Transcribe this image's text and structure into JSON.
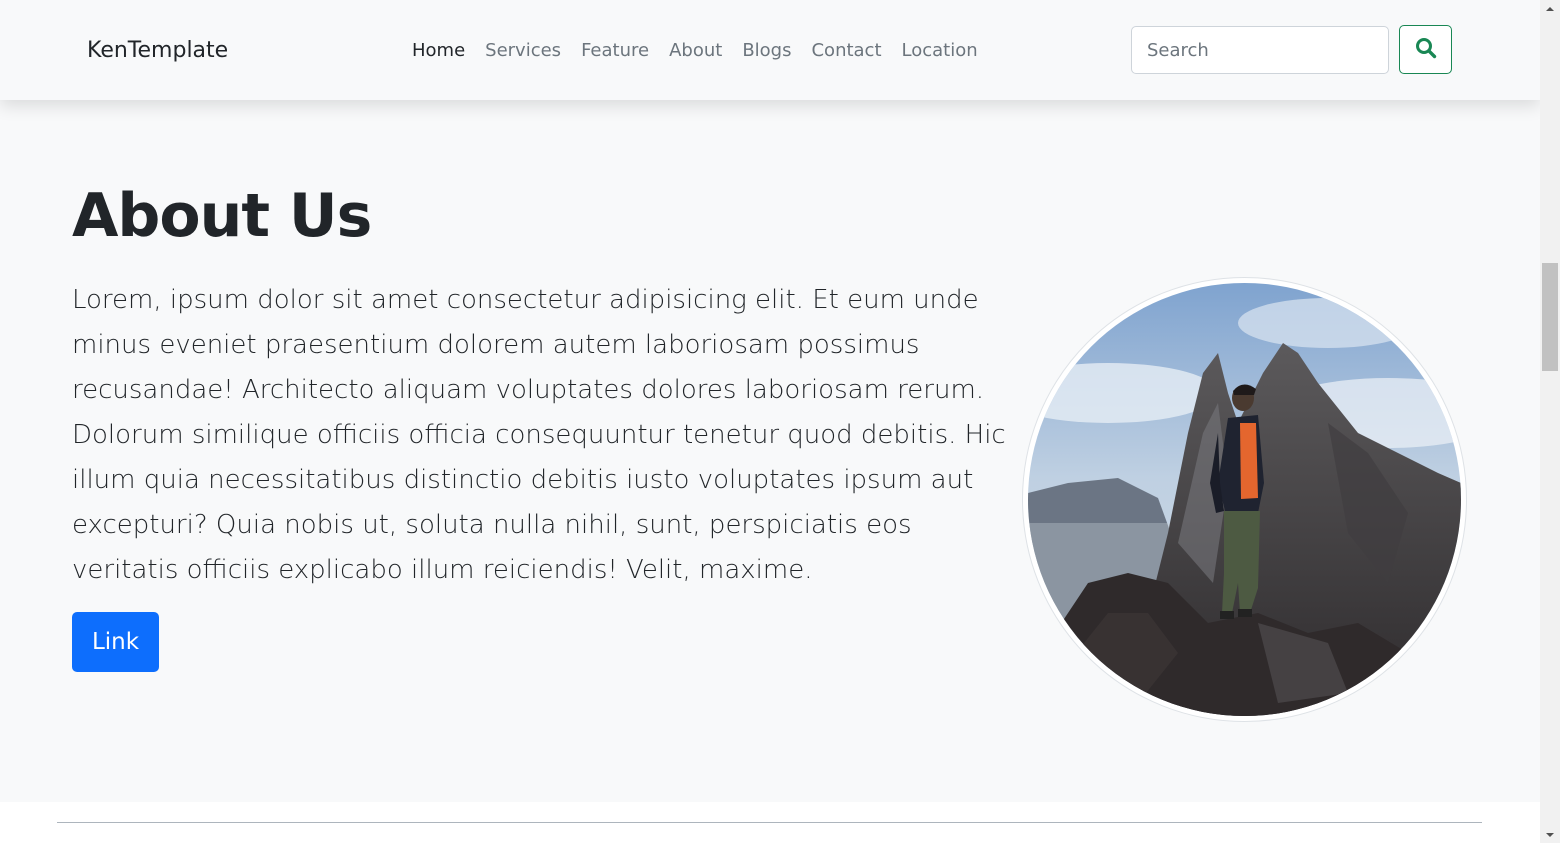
{
  "navbar": {
    "brand": "KenTemplate",
    "links": [
      {
        "label": "Home",
        "active": true
      },
      {
        "label": "Services",
        "active": false
      },
      {
        "label": "Feature",
        "active": false
      },
      {
        "label": "About",
        "active": false
      },
      {
        "label": "Blogs",
        "active": false
      },
      {
        "label": "Contact",
        "active": false
      },
      {
        "label": "Location",
        "active": false
      }
    ],
    "search": {
      "placeholder": "Search",
      "value": "",
      "icon": "search-icon"
    }
  },
  "about": {
    "title": "About Us",
    "text": "Lorem, ipsum dolor sit amet consectetur adipisicing elit. Et eum unde minus eveniet praesentium dolorem autem laboriosam possimus recusandae! Architecto aliquam voluptates dolores laboriosam rerum. Dolorum similique officiis officia consequuntur tenetur quod debitis. Hic illum quia necessitatibus distinctio debitis iusto voluptates ipsum aut excepturi? Quia nobis ut, soluta nulla nihil, sunt, perspiciatis eos veritatis officiis explicabo illum reiciendis! Velit, maxime.",
    "button_label": "Link",
    "image": "profile-photo"
  },
  "colors": {
    "primary": "#0d6efd",
    "success": "#198754",
    "light_bg": "#f8f9fa",
    "text": "#212529",
    "muted": "#6c757d"
  }
}
